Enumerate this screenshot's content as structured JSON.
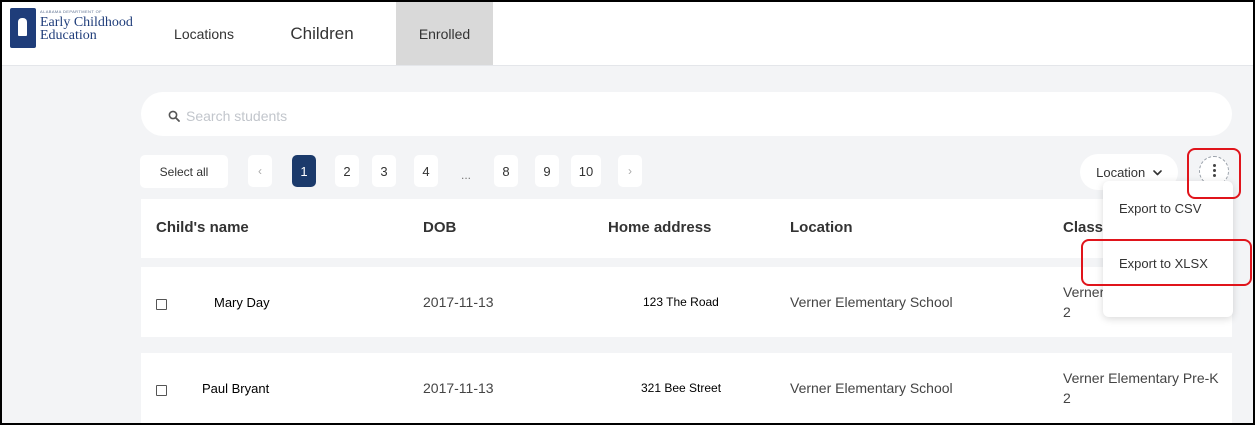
{
  "logo": {
    "small_text": "ALABAMA DEPARTMENT OF",
    "line1": "Early Childhood",
    "line2": "Education"
  },
  "nav": {
    "tabs": [
      {
        "label": "Locations",
        "active": false
      },
      {
        "label": "Children",
        "active": false
      },
      {
        "label": "Enrolled",
        "active": true
      }
    ]
  },
  "search": {
    "placeholder": "Search students",
    "value": ""
  },
  "toolbar": {
    "select_all_label": "Select all",
    "location_filter_label": "Location",
    "more_icon": "more-vertical-icon"
  },
  "pagination": {
    "prev_symbol": "‹",
    "next_symbol": "›",
    "ellipsis": "...",
    "pages": [
      "1",
      "2",
      "3",
      "4",
      "8",
      "9",
      "10"
    ],
    "current_page": "1"
  },
  "table": {
    "columns": [
      "Child's name",
      "DOB",
      "Home address",
      "Location",
      "Classroom"
    ],
    "rows": [
      {
        "name": "Mary Day",
        "dob": "2017-11-13",
        "address": "123 The Road",
        "location": "Verner Elementary School",
        "classroom": "Verner Elementary Pre-K 2"
      },
      {
        "name": "Paul Bryant",
        "dob": "2017-11-13",
        "address": "321 Bee Street",
        "location": "Verner Elementary School",
        "classroom": "Verner Elementary Pre-K 2"
      }
    ]
  },
  "export_menu": {
    "items": [
      "Export to CSV",
      "Export to XLSX"
    ]
  },
  "colors": {
    "active_page": "#1b3a6b",
    "active_tab_bg": "#d9d9d9",
    "highlight": "#e0141b",
    "background": "#f3f4f6"
  }
}
